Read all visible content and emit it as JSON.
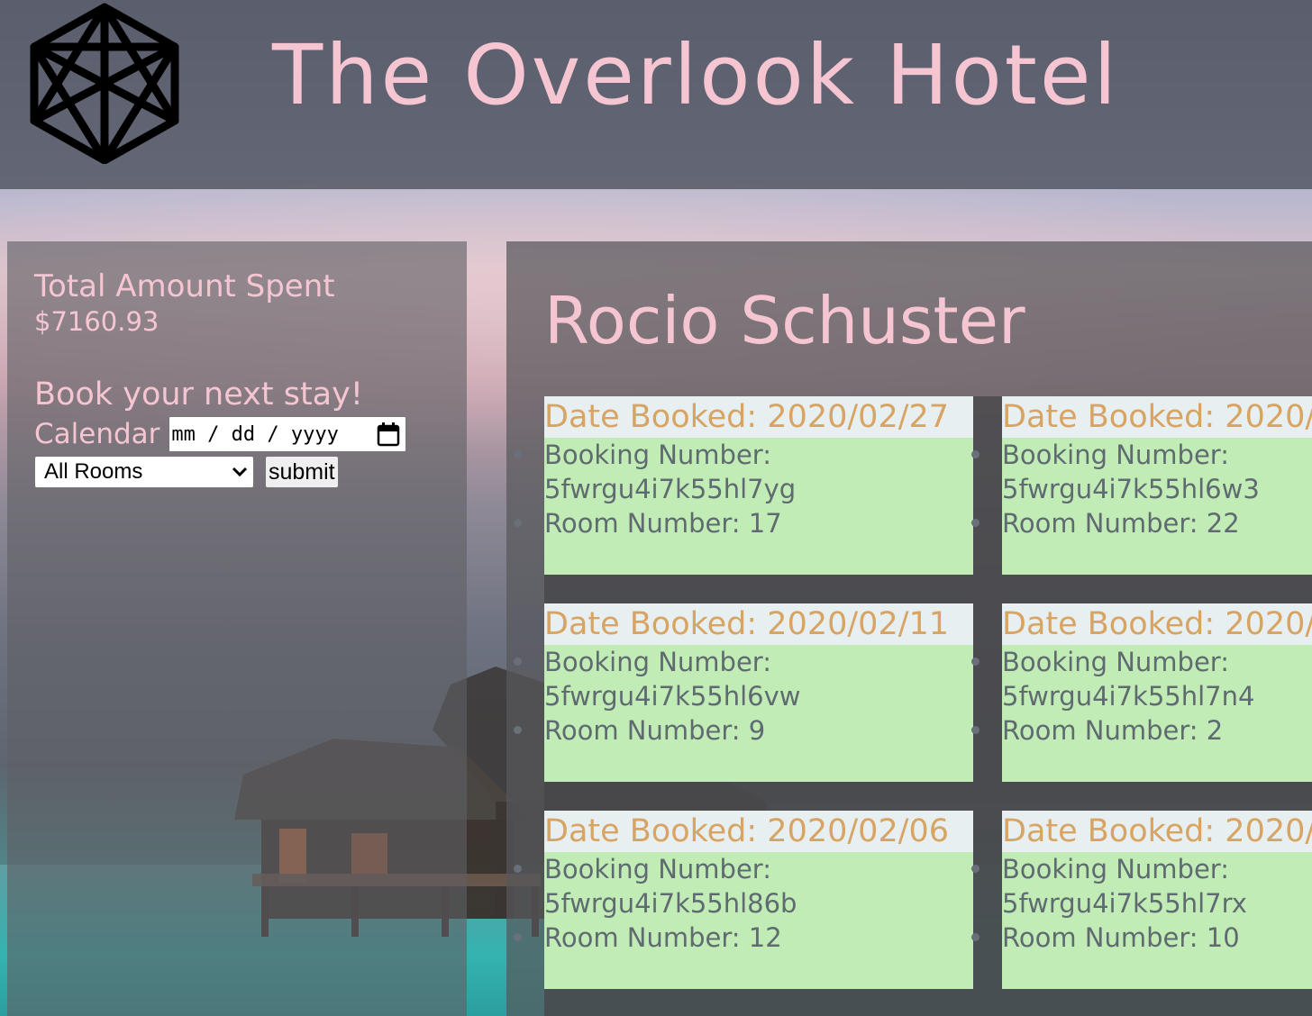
{
  "header": {
    "title": "The Overlook Hotel",
    "logo_icon": "hexagon-cube-logo-icon"
  },
  "sidebar": {
    "spent_label": "Total Amount Spent",
    "spent_value": "$7160.93",
    "book_heading": "Book your next stay!",
    "calendar_label": "Calendar",
    "date_placeholder": "mm / dd / yyyy",
    "room_select": {
      "selected": "All Rooms"
    },
    "submit_label": "submit"
  },
  "main": {
    "guest_name": "Rocio Schuster",
    "bookings": [
      {
        "date": "Date Booked: 2020/02/27",
        "number_label": "Booking Number:",
        "number": "5fwrgu4i7k55hl7yg",
        "room": "Room Number: 17"
      },
      {
        "date": "Date Booked: 2020/",
        "number_label": "Booking Number:",
        "number": "5fwrgu4i7k55hl6w3",
        "room": "Room Number: 22"
      },
      {
        "date": "Date Booked: 2020/02/11",
        "number_label": "Booking Number:",
        "number": "5fwrgu4i7k55hl6vw",
        "room": "Room Number: 9"
      },
      {
        "date": "Date Booked: 2020/",
        "number_label": "Booking Number:",
        "number": "5fwrgu4i7k55hl7n4",
        "room": "Room Number: 2"
      },
      {
        "date": "Date Booked: 2020/02/06",
        "number_label": "Booking Number:",
        "number": "5fwrgu4i7k55hl86b",
        "room": "Room Number: 12"
      },
      {
        "date": "Date Booked: 2020/",
        "number_label": "Booking Number:",
        "number": "5fwrgu4i7k55hl7rx",
        "room": "Room Number: 10"
      }
    ]
  },
  "colors": {
    "title_pink": "#f5c6d2",
    "card_green": "#c2ecb5",
    "date_orange": "#d7a463",
    "card_text": "#5f6b70"
  }
}
